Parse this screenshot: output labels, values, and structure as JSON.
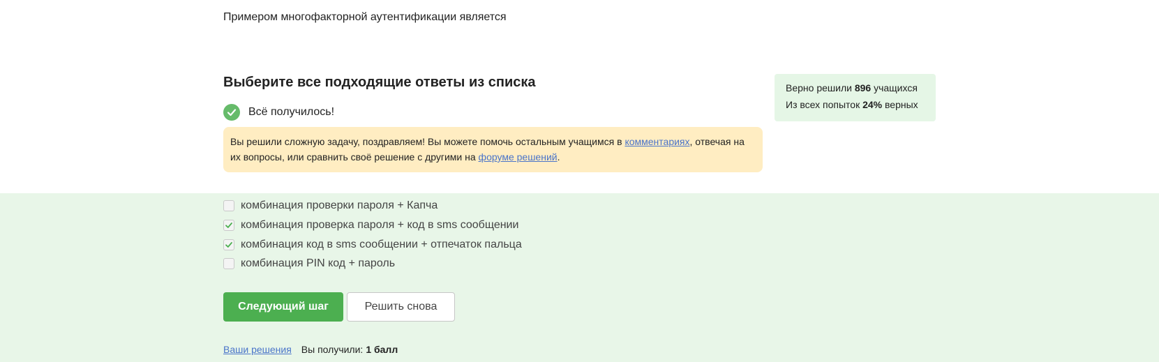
{
  "question": "Примером многофакторной аутентификации является",
  "heading": "Выберите все подходящие ответы из списка",
  "result": "Всё получилось!",
  "hint": {
    "part1": "Вы решили сложную задачу, поздравляем! Вы можете помочь остальным учащимся в ",
    "link1": "комментариях",
    "part2": ", отвечая на их вопросы, или сравнить своё решение с другими на ",
    "link2": "форуме решений",
    "part3": "."
  },
  "stats": {
    "line1_prefix": "Верно решили ",
    "solved_count": "896",
    "line1_suffix": " учащихся",
    "line2_prefix": "Из всех попыток ",
    "percent": "24%",
    "line2_suffix": " верных"
  },
  "options": [
    {
      "label": "комбинация проверки пароля + Капча",
      "checked": false
    },
    {
      "label": "комбинация проверка пароля + код в sms сообщении",
      "checked": true
    },
    {
      "label": "комбинация код в sms сообщении + отпечаток пальца",
      "checked": true
    },
    {
      "label": "комбинация PIN код + пароль",
      "checked": false
    }
  ],
  "buttons": {
    "next": "Следующий шаг",
    "retry": "Решить снова"
  },
  "footer": {
    "solutions_link": "Ваши решения",
    "score_prefix": "Вы получили:",
    "score": "1 балл"
  },
  "colors": {
    "accent_green": "#4caf50",
    "answers_bg": "#e8f6e8",
    "hint_bg": "#ffedc2",
    "link": "#4a74c9"
  }
}
